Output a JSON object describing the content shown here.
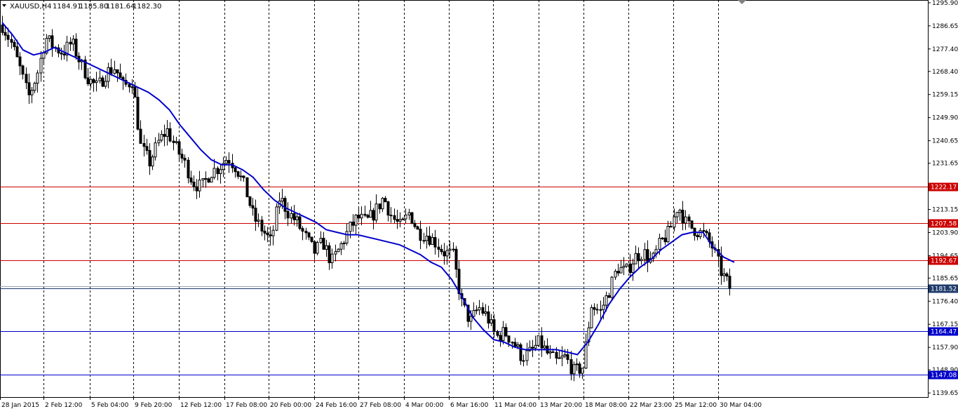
{
  "header": {
    "symbol": "XAUUSD,H4",
    "open": "1184.91",
    "high": "1185.80",
    "low": "1181.64",
    "close": "1182.30"
  },
  "colors": {
    "background": "#ffffff",
    "candle": "#000000",
    "moving_average": "#0000cc",
    "resistance": "#cc0000",
    "support": "#0000cc",
    "current_price": "#1f3b6b",
    "grid": "#000000"
  },
  "chart_data": {
    "type": "candlestick",
    "title": "",
    "xlabel": "",
    "ylabel": "",
    "ylim": [
      1138.0,
      1297.0
    ],
    "grid": "vertical-dashed",
    "y_ticks": [
      "1295.90",
      "1286.65",
      "1277.40",
      "1268.40",
      "1259.15",
      "1249.90",
      "1240.65",
      "1231.65",
      "1222.40",
      "1213.15",
      "1203.90",
      "1194.65",
      "1185.65",
      "1176.40",
      "1167.15",
      "1157.90",
      "1148.90",
      "1139.65"
    ],
    "x_ticks": [
      "28 Jan 2015",
      "2 Feb 12:00",
      "5 Feb 04:00",
      "9 Feb 20:00",
      "12 Feb 12:00",
      "17 Feb 08:00",
      "20 Feb 00:00",
      "24 Feb 16:00",
      "27 Feb 08:00",
      "4 Mar 00:00",
      "6 Mar 16:00",
      "11 Mar 04:00",
      "13 Mar 20:00",
      "18 Mar 08:00",
      "22 Mar 23:00",
      "25 Mar 12:00",
      "30 Mar 04:00"
    ],
    "horizontal_levels": [
      {
        "value": 1222.17,
        "label": "1222.17",
        "kind": "resistance"
      },
      {
        "value": 1207.58,
        "label": "1207.58",
        "kind": "resistance"
      },
      {
        "value": 1192.67,
        "label": "1192.67",
        "kind": "resistance"
      },
      {
        "value": 1181.52,
        "label": "1181.52",
        "kind": "current"
      },
      {
        "value": 1164.47,
        "label": "1164.47",
        "kind": "support"
      },
      {
        "value": 1147.08,
        "label": "1147.08",
        "kind": "support"
      }
    ],
    "price_path": [
      1287,
      1280,
      1270,
      1258,
      1267,
      1282,
      1278,
      1276,
      1280,
      1272,
      1265,
      1262,
      1268,
      1270,
      1262,
      1265,
      1238,
      1232,
      1240,
      1245,
      1238,
      1232,
      1224,
      1222,
      1228,
      1230,
      1234,
      1230,
      1222,
      1210,
      1205,
      1200,
      1218,
      1212,
      1208,
      1202,
      1196,
      1200,
      1192,
      1198,
      1205,
      1210,
      1208,
      1212,
      1218,
      1210,
      1206,
      1212,
      1204,
      1203,
      1200,
      1196,
      1195,
      1176,
      1168,
      1174,
      1170,
      1162,
      1164,
      1160,
      1154,
      1156,
      1160,
      1155,
      1152,
      1154,
      1148,
      1150,
      1175,
      1172,
      1180,
      1190,
      1188,
      1194,
      1196,
      1192,
      1200,
      1204,
      1215,
      1207,
      1205,
      1203,
      1198,
      1188,
      1182
    ],
    "moving_average_path": [
      1288,
      1283,
      1277,
      1275,
      1276,
      1278,
      1276,
      1274,
      1272,
      1270,
      1268,
      1266,
      1264,
      1262,
      1260,
      1257,
      1253,
      1247,
      1242,
      1237,
      1233,
      1231,
      1231,
      1229,
      1226,
      1221,
      1217,
      1214,
      1212,
      1210,
      1208,
      1205,
      1204,
      1203,
      1203,
      1202,
      1201,
      1200,
      1199,
      1197,
      1195,
      1192,
      1190,
      1185,
      1178,
      1170,
      1165,
      1161,
      1160,
      1158,
      1157,
      1157,
      1157,
      1157,
      1156,
      1155,
      1160,
      1167,
      1175,
      1181,
      1186,
      1190,
      1193,
      1197,
      1200,
      1203,
      1204,
      1204,
      1198,
      1194,
      1192
    ]
  }
}
